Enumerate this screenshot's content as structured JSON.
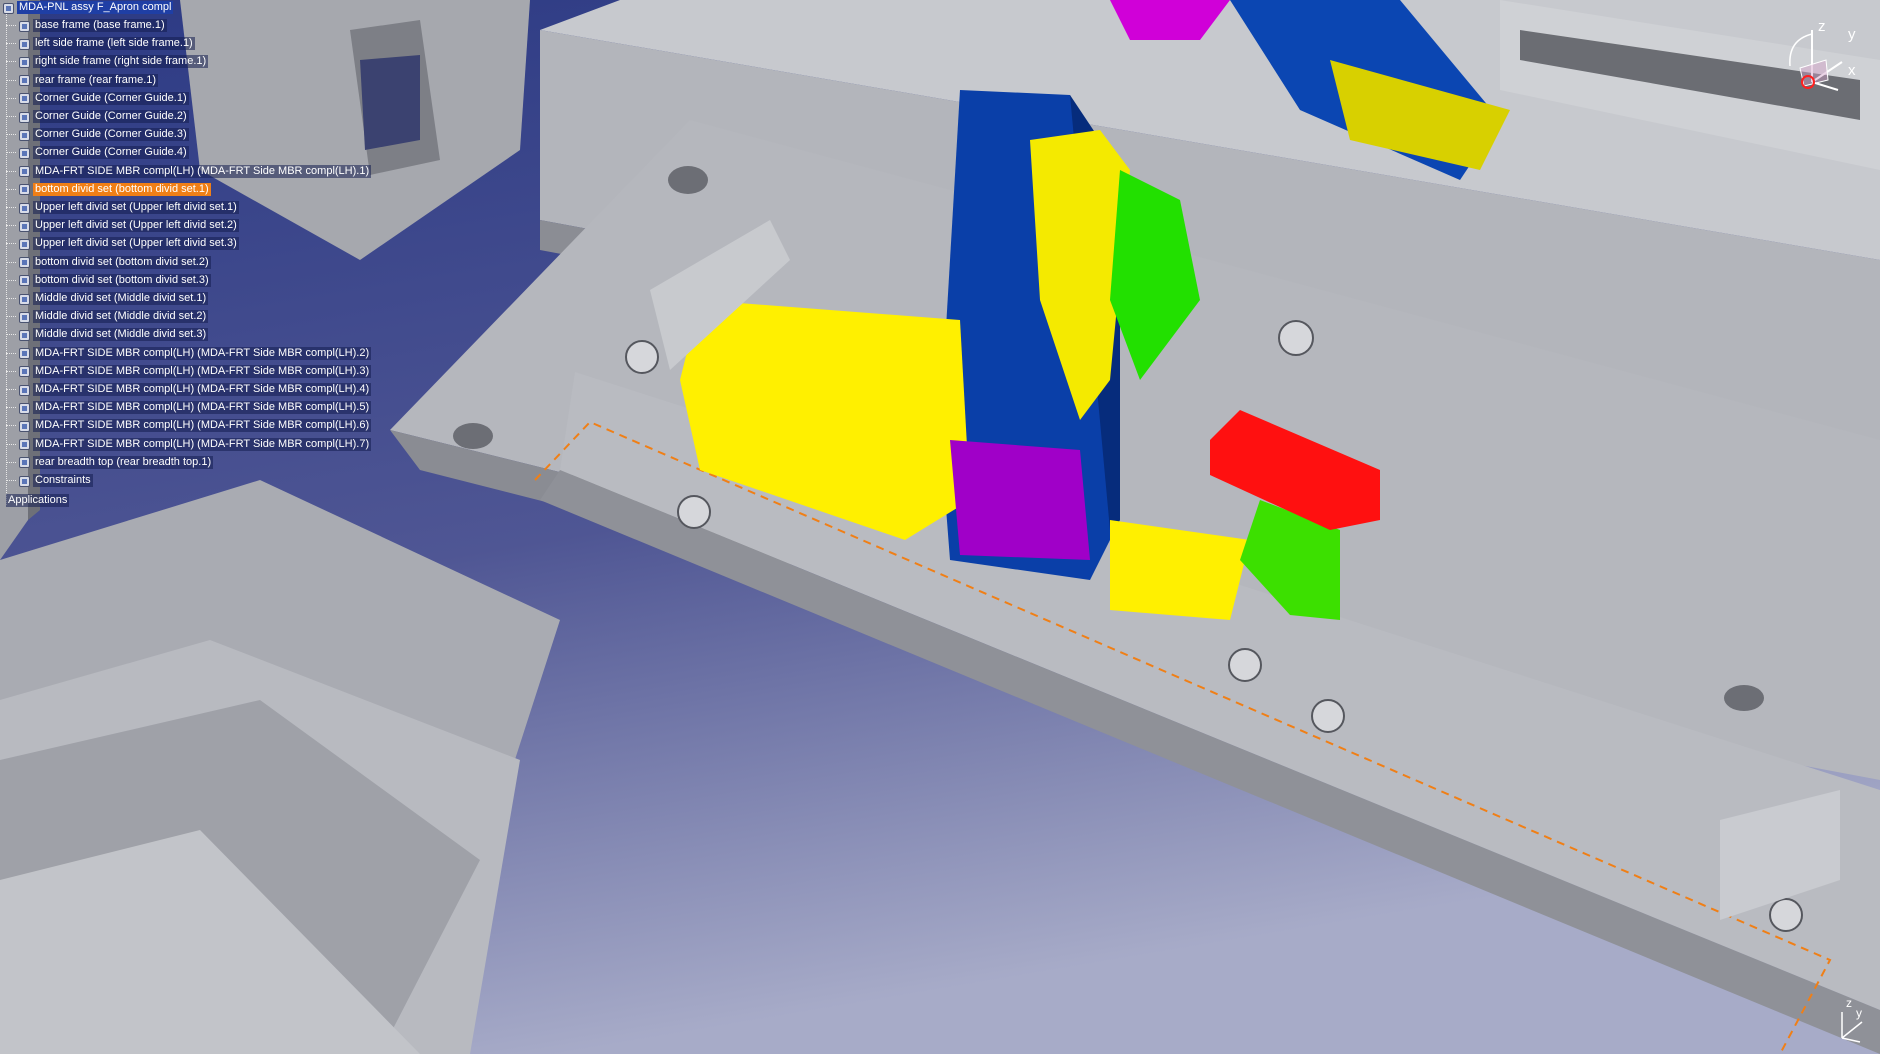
{
  "tree": {
    "root": "MDA-PNL assy F_Apron compl",
    "items": [
      "base frame (base frame.1)",
      "left side frame (left side frame.1)",
      "right side frame (right side frame.1)",
      "rear frame (rear frame.1)",
      "Corner Guide (Corner Guide.1)",
      "Corner Guide (Corner Guide.2)",
      "Corner Guide (Corner Guide.3)",
      "Corner Guide (Corner Guide.4)",
      "MDA-FRT SIDE MBR compl(LH) (MDA-FRT Side MBR compl(LH).1)",
      "bottom divid set (bottom divid set.1)",
      "Upper left divid set (Upper left divid set.1)",
      "Upper left divid set (Upper left divid set.2)",
      "Upper left divid set (Upper left divid set.3)",
      "bottom divid set (bottom divid set.2)",
      "bottom divid set (bottom divid set.3)",
      "Middle divid set (Middle divid set.1)",
      "Middle divid set (Middle divid set.2)",
      "Middle divid set (Middle divid set.3)",
      "MDA-FRT SIDE MBR compl(LH) (MDA-FRT Side MBR compl(LH).2)",
      "MDA-FRT SIDE MBR compl(LH) (MDA-FRT Side MBR compl(LH).3)",
      "MDA-FRT SIDE MBR compl(LH) (MDA-FRT Side MBR compl(LH).4)",
      "MDA-FRT SIDE MBR compl(LH) (MDA-FRT Side MBR compl(LH).5)",
      "MDA-FRT SIDE MBR compl(LH) (MDA-FRT Side MBR compl(LH).6)",
      "MDA-FRT SIDE MBR compl(LH) (MDA-FRT Side MBR compl(LH).7)",
      "rear breadth top (rear breadth top.1)",
      "Constraints"
    ],
    "highlighted_index": 9,
    "applications": "Applications"
  },
  "compass": {
    "x": "x",
    "y": "y",
    "z": "z"
  },
  "axis_small": {
    "z": "z",
    "y": "y"
  },
  "colors": {
    "background_top": "#2f3d86",
    "background_bottom": "#9aa0c2",
    "frame_grey": "#aeb0b6",
    "frame_dark": "#6e7078",
    "part_blue": "#0a3fa8",
    "part_yellow": "#fff000",
    "part_green": "#22e000",
    "part_red": "#ff1010",
    "part_magenta": "#a000c8",
    "selection_orange": "#f07f16"
  }
}
